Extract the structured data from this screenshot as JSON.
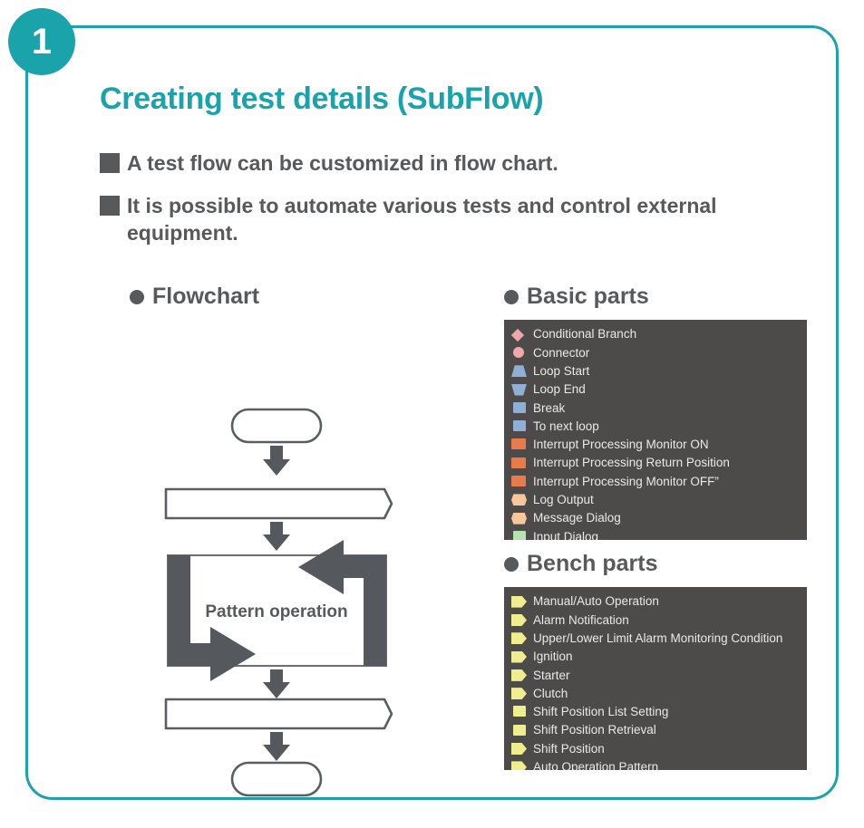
{
  "slide": {
    "step_number": "1",
    "title": "Creating test details (SubFlow)",
    "accent_color": "#1BA3AC",
    "text_color": "#57595B",
    "panel_bg": "#4D4B4A"
  },
  "bullets": [
    {
      "text": "A test flow can be customized in flow chart."
    },
    {
      "text": "It is possible to automate various tests and control external equipment."
    }
  ],
  "flowchart": {
    "heading": "Flowchart",
    "loop_label": "Pattern operation",
    "shape_stroke": "#5A5E62",
    "arrow_color": "#55595E",
    "nodes": [
      {
        "type": "terminator",
        "label": ""
      },
      {
        "type": "band",
        "label": ""
      },
      {
        "type": "loop",
        "label": "Pattern operation"
      },
      {
        "type": "band",
        "label": ""
      },
      {
        "type": "terminator",
        "label": ""
      }
    ]
  },
  "basic_parts": {
    "heading": "Basic parts",
    "items": [
      {
        "label": "Conditional Branch",
        "icon": "diamond-icon",
        "shape": "ic-diamond",
        "color": "#EFA7AB"
      },
      {
        "label": "Connector",
        "icon": "circle-icon",
        "shape": "ic-circle",
        "color": "#EFA7AB"
      },
      {
        "label": "Loop Start",
        "icon": "trapezoid-up-icon",
        "shape": "ic-trap-up",
        "color": "#8FAFD4"
      },
      {
        "label": "Loop End",
        "icon": "trapezoid-down-icon",
        "shape": "ic-trap-down",
        "color": "#8FAFD4"
      },
      {
        "label": "Break",
        "icon": "square-icon",
        "shape": "ic-square",
        "color": "#8FAFD4"
      },
      {
        "label": "To next loop",
        "icon": "square-icon",
        "shape": "ic-square",
        "color": "#8FAFD4"
      },
      {
        "label": "Interrupt Processing Monitor ON",
        "icon": "rectangle-icon",
        "shape": "ic-rect",
        "color": "#E87B4A"
      },
      {
        "label": "Interrupt Processing Return Position",
        "icon": "rectangle-icon",
        "shape": "ic-rect",
        "color": "#E87B4A"
      },
      {
        "label": "Interrupt Processing Monitor OFF”",
        "icon": "rectangle-icon",
        "shape": "ic-rect",
        "color": "#E87B4A"
      },
      {
        "label": "Log Output",
        "icon": "hexagon-icon",
        "shape": "ic-hex",
        "color": "#F5C79B"
      },
      {
        "label": "Message Dialog",
        "icon": "hexagon-icon",
        "shape": "ic-hex",
        "color": "#F5C79B"
      },
      {
        "label": "Input Dialog",
        "icon": "square-icon",
        "shape": "ic-square",
        "color": "#B9E0B0"
      }
    ]
  },
  "bench_parts": {
    "heading": "Bench parts",
    "items": [
      {
        "label": "Manual/Auto Operation",
        "icon": "pentagon-icon",
        "shape": "ic-pent",
        "color": "#EEEE8E"
      },
      {
        "label": "Alarm Notification",
        "icon": "pentagon-icon",
        "shape": "ic-pent",
        "color": "#EEEE8E"
      },
      {
        "label": "Upper/Lower Limit Alarm Monitoring Condition",
        "icon": "pentagon-icon",
        "shape": "ic-pent",
        "color": "#EEEE8E"
      },
      {
        "label": "Ignition",
        "icon": "pentagon-icon",
        "shape": "ic-pent",
        "color": "#EEEE8E"
      },
      {
        "label": "Starter",
        "icon": "pentagon-icon",
        "shape": "ic-pent",
        "color": "#EEEE8E"
      },
      {
        "label": "Clutch",
        "icon": "pentagon-icon",
        "shape": "ic-pent",
        "color": "#EEEE8E"
      },
      {
        "label": "Shift Position List Setting",
        "icon": "square-icon",
        "shape": "ic-square",
        "color": "#EEEE8E"
      },
      {
        "label": "Shift Position Retrieval",
        "icon": "square-icon",
        "shape": "ic-square",
        "color": "#EEEE8E"
      },
      {
        "label": "Shift Position",
        "icon": "pentagon-icon",
        "shape": "ic-pent",
        "color": "#EEEE8E"
      },
      {
        "label": "Auto Operation Pattern",
        "icon": "pentagon-icon",
        "shape": "ic-pent",
        "color": "#EEEE8E"
      }
    ]
  }
}
